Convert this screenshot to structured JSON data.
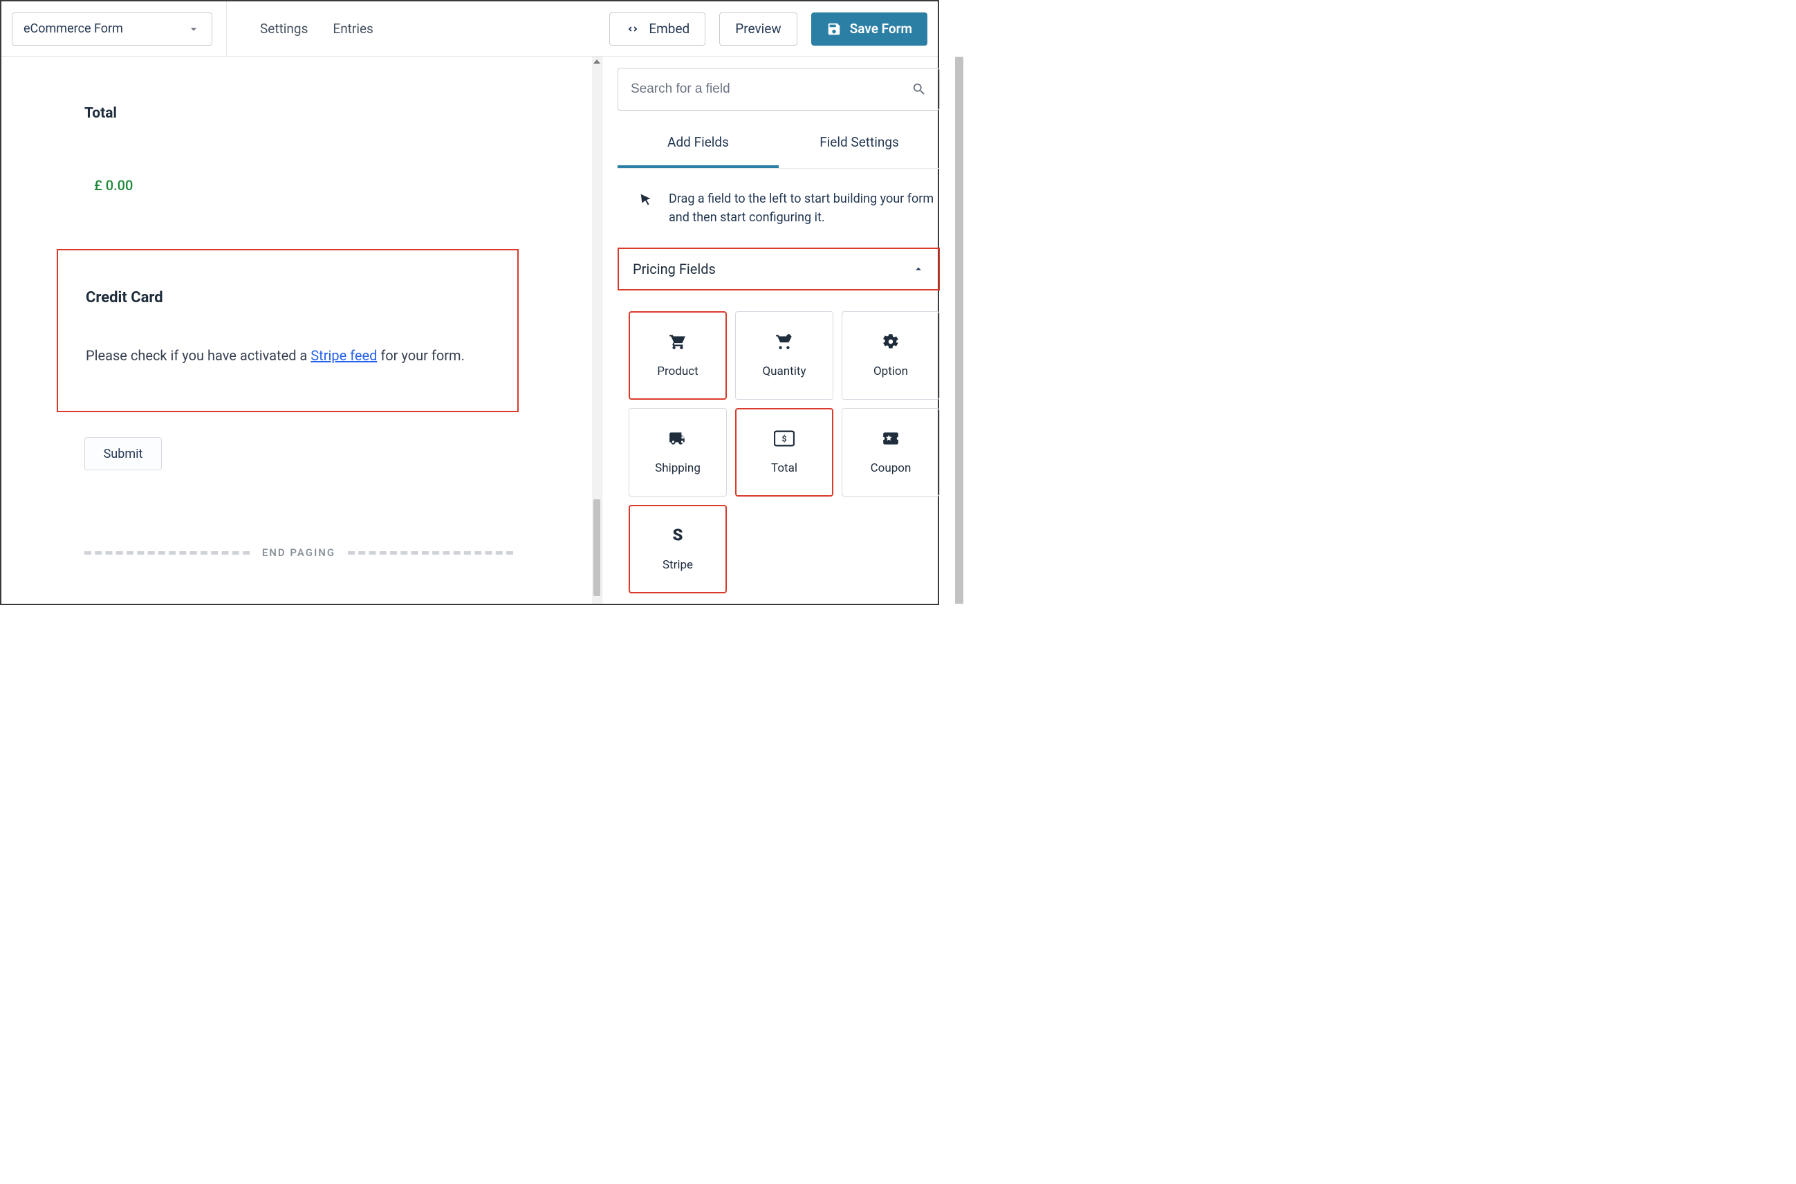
{
  "header": {
    "form_name": "eCommerce Form",
    "nav": {
      "settings": "Settings",
      "entries": "Entries"
    },
    "embed": "Embed",
    "preview": "Preview",
    "save": "Save Form"
  },
  "canvas": {
    "total_label": "Total",
    "total_value": "£ 0.00",
    "cc_title": "Credit Card",
    "cc_msg_pre": "Please check if you have activated a ",
    "cc_link": "Stripe feed",
    "cc_msg_post": " for your form.",
    "submit": "Submit",
    "end_paging": "END PAGING"
  },
  "sidebar": {
    "search_placeholder": "Search for a field",
    "tab_add": "Add Fields",
    "tab_settings": "Field Settings",
    "helper": "Drag a field to the left to start building your form and then start configuring it.",
    "section": "Pricing Fields",
    "fields": {
      "product": "Product",
      "quantity": "Quantity",
      "option": "Option",
      "shipping": "Shipping",
      "total": "Total",
      "coupon": "Coupon",
      "stripe": "Stripe"
    }
  }
}
